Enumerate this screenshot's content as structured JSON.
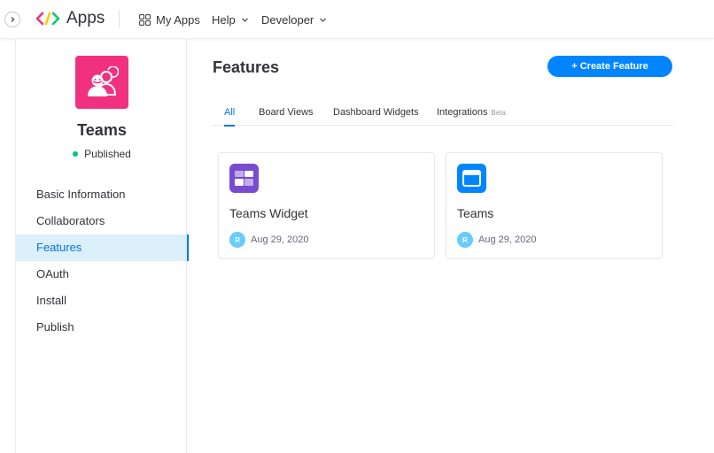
{
  "topbar": {
    "brand_title": "Apps",
    "nav": [
      {
        "label": "My Apps",
        "icon": "grid-icon"
      },
      {
        "label": "Help",
        "icon": "chevron-down-icon"
      },
      {
        "label": "Developer",
        "icon": "chevron-down-icon"
      }
    ]
  },
  "colors": {
    "primary": "#0085ff",
    "accent_text": "#0073ea",
    "app_icon_bg": "#f1317f",
    "status_green": "#00c875",
    "active_menu_bg": "#dcf0fb"
  },
  "sidebar": {
    "app_name": "Teams",
    "status": "Published",
    "items": [
      {
        "label": "Basic Information",
        "active": false
      },
      {
        "label": "Collaborators",
        "active": false
      },
      {
        "label": "Features",
        "active": true
      },
      {
        "label": "OAuth",
        "active": false
      },
      {
        "label": "Install",
        "active": false
      },
      {
        "label": "Publish",
        "active": false
      }
    ]
  },
  "main": {
    "title": "Features",
    "create_button": "+ Create Feature",
    "tabs": [
      {
        "label": "All",
        "active": true
      },
      {
        "label": "Board Views",
        "active": false
      },
      {
        "label": "Dashboard Widgets",
        "active": false
      },
      {
        "label": "Integrations",
        "active": false,
        "badge": "Beta"
      }
    ],
    "cards": [
      {
        "title": "Teams Widget",
        "icon": "widget-icon",
        "icon_color": "#784bd1",
        "avatar": "R",
        "date": "Aug 29, 2020"
      },
      {
        "title": "Teams",
        "icon": "board-view-icon",
        "icon_color": "#0085ff",
        "avatar": "R",
        "date": "Aug 29, 2020"
      }
    ]
  }
}
